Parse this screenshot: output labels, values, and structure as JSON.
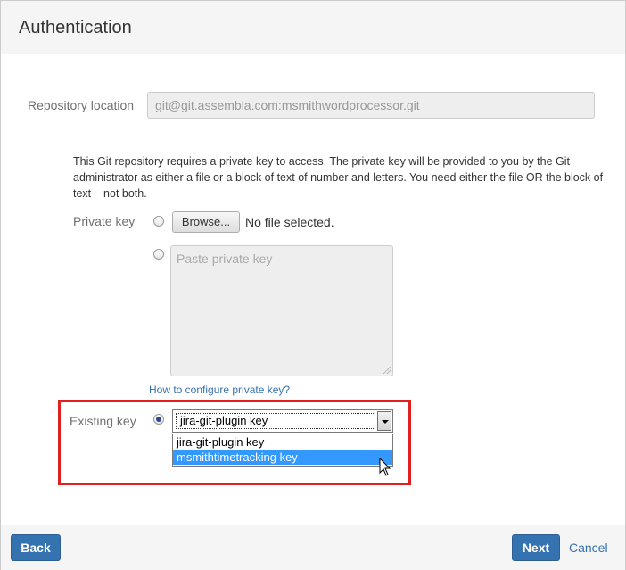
{
  "dialog": {
    "title": "Authentication"
  },
  "repository": {
    "label": "Repository location",
    "value": "git@git.assembla.com:msmithwordprocessor.git"
  },
  "description": "This Git repository requires a private key to access. The private key will be provided to you by the Git administrator as either a file or a block of text of number and letters. You need either the file OR the block of text – not both.",
  "private_key": {
    "label": "Private key",
    "browse_label": "Browse...",
    "no_file_text": "No file selected.",
    "paste_placeholder": "Paste private key",
    "help_link": "How to configure private key?"
  },
  "existing_key": {
    "label": "Existing key",
    "selected_value": "jira-git-plugin key",
    "options": [
      {
        "label": "jira-git-plugin key",
        "highlighted": false
      },
      {
        "label": "msmithtimetracking key",
        "highlighted": true
      }
    ]
  },
  "footer": {
    "back_label": "Back",
    "next_label": "Next",
    "cancel_label": "Cancel"
  },
  "colors": {
    "primary": "#3572b0",
    "highlight_box": "#e01f1f",
    "selected_option": "#3399ff"
  }
}
